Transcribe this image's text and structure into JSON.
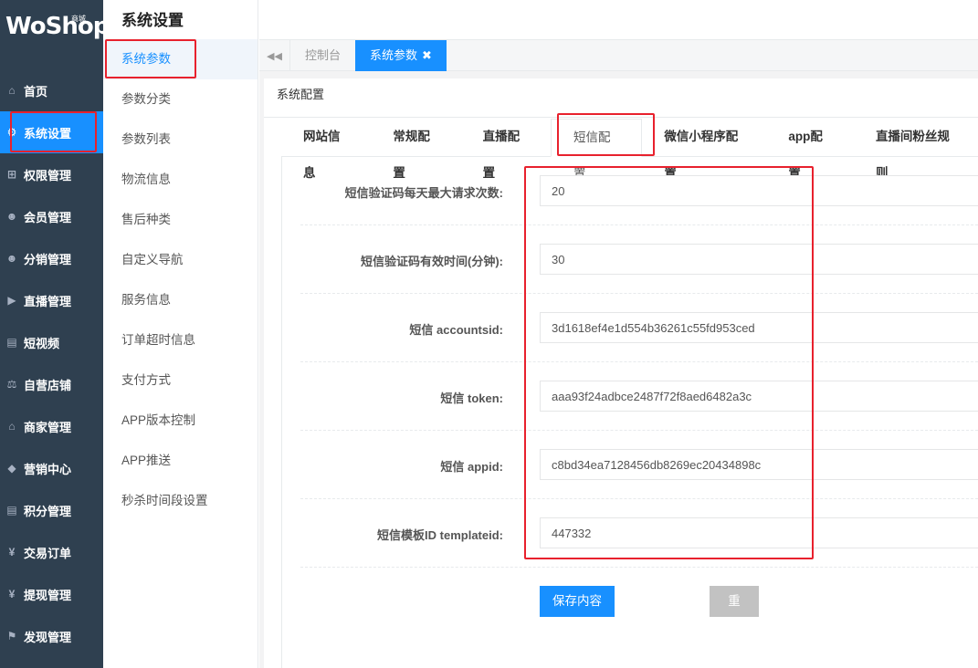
{
  "logo": {
    "brand": "WoShop",
    "mall": "商城"
  },
  "nav": [
    {
      "label": "首页",
      "icon": "home-icon",
      "glyph": "⌂"
    },
    {
      "label": "系统设置",
      "icon": "gear-icon",
      "glyph": "⚙"
    },
    {
      "label": "权限管理",
      "icon": "sitemap-icon",
      "glyph": "⊞"
    },
    {
      "label": "会员管理",
      "icon": "users-icon",
      "glyph": "☻"
    },
    {
      "label": "分销管理",
      "icon": "users-icon",
      "glyph": "☻"
    },
    {
      "label": "直播管理",
      "icon": "video-icon",
      "glyph": "▶"
    },
    {
      "label": "短视频",
      "icon": "file-icon",
      "glyph": "▤"
    },
    {
      "label": "自营店铺",
      "icon": "scale-icon",
      "glyph": "⚖"
    },
    {
      "label": "商家管理",
      "icon": "bank-icon",
      "glyph": "⌂"
    },
    {
      "label": "营销中心",
      "icon": "tag-icon",
      "glyph": "◆"
    },
    {
      "label": "积分管理",
      "icon": "file-icon",
      "glyph": "▤"
    },
    {
      "label": "交易订单",
      "icon": "yen-icon",
      "glyph": "¥"
    },
    {
      "label": "提现管理",
      "icon": "yen-icon",
      "glyph": "¥"
    },
    {
      "label": "发现管理",
      "icon": "flag-icon",
      "glyph": "⚑"
    }
  ],
  "sub": {
    "title": "系统设置",
    "items": [
      "系统参数",
      "参数分类",
      "参数列表",
      "物流信息",
      "售后种类",
      "自定义导航",
      "服务信息",
      "订单超时信息",
      "支付方式",
      "APP版本控制",
      "APP推送",
      "秒杀时间段设置"
    ]
  },
  "tabs": {
    "home": "控制台",
    "current": "系统参数",
    "close": "✖"
  },
  "panel": {
    "title": "系统配置"
  },
  "config_tabs": [
    "网站信息",
    "常规配置",
    "直播配置",
    "短信配置",
    "微信小程序配置",
    "app配置",
    "直播间粉丝规则"
  ],
  "fields": [
    {
      "label": "短信验证码每天最大请求次数:",
      "value": "20"
    },
    {
      "label": "短信验证码有效时间(分钟):",
      "value": "30"
    },
    {
      "label": "短信 accountsid:",
      "value": "3d1618ef4e1d554b36261c55fd953ced"
    },
    {
      "label": "短信 token:",
      "value": "aaa93f24adbce2487f72f8aed6482a3c"
    },
    {
      "label": "短信 appid:",
      "value": "c8bd34ea7128456db8269ec20434898c"
    },
    {
      "label": "短信模板ID templateid:",
      "value": "447332"
    }
  ],
  "buttons": {
    "save": "保存内容",
    "reset": "重置"
  },
  "colors": {
    "sidebar": "#2f4050",
    "accent": "#1890ff",
    "highlight": "#e8212d"
  }
}
